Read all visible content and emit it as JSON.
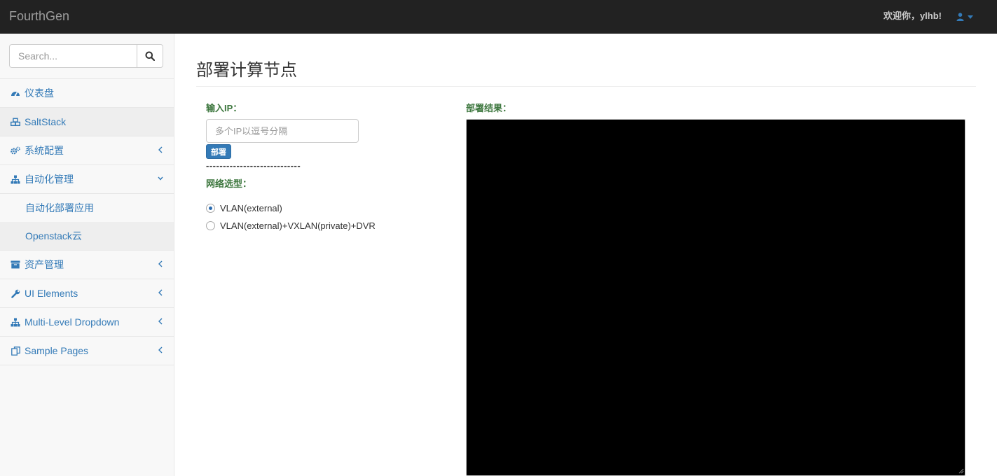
{
  "navbar": {
    "brand": "FourthGen",
    "welcome": "欢迎你，ylhb!"
  },
  "sidebar": {
    "search": {
      "placeholder": "Search..."
    },
    "items": [
      {
        "label": "仪表盘",
        "icon": "dashboard-icon"
      },
      {
        "label": "SaltStack",
        "icon": "cubes-icon"
      },
      {
        "label": "系统配置",
        "icon": "cogs-icon"
      },
      {
        "label": "自动化管理",
        "icon": "sitemap-icon"
      },
      {
        "label": "资产管理",
        "icon": "archive-icon"
      },
      {
        "label": "UI Elements",
        "icon": "wrench-icon"
      },
      {
        "label": "Multi-Level Dropdown",
        "icon": "sitemap-icon"
      },
      {
        "label": "Sample Pages",
        "icon": "files-icon"
      }
    ],
    "subitems": [
      {
        "label": "自动化部署应用"
      },
      {
        "label": "Openstack云"
      }
    ]
  },
  "main": {
    "title": "部署计算节点",
    "ip_label": "输入IP：",
    "ip_placeholder": "多个IP以逗号分隔",
    "deploy_button": "部署",
    "separator": "----------------------------",
    "network_label": "网络选型：",
    "options": [
      {
        "label": "VLAN(external)",
        "checked": true
      },
      {
        "label": "VLAN(external)+VXLAN(private)+DVR",
        "checked": false
      }
    ],
    "result_label": "部署结果："
  },
  "colors": {
    "navbar_bg": "#222222",
    "link": "#337ab7",
    "label_green": "#3c763d",
    "result_bg": "#000000"
  }
}
